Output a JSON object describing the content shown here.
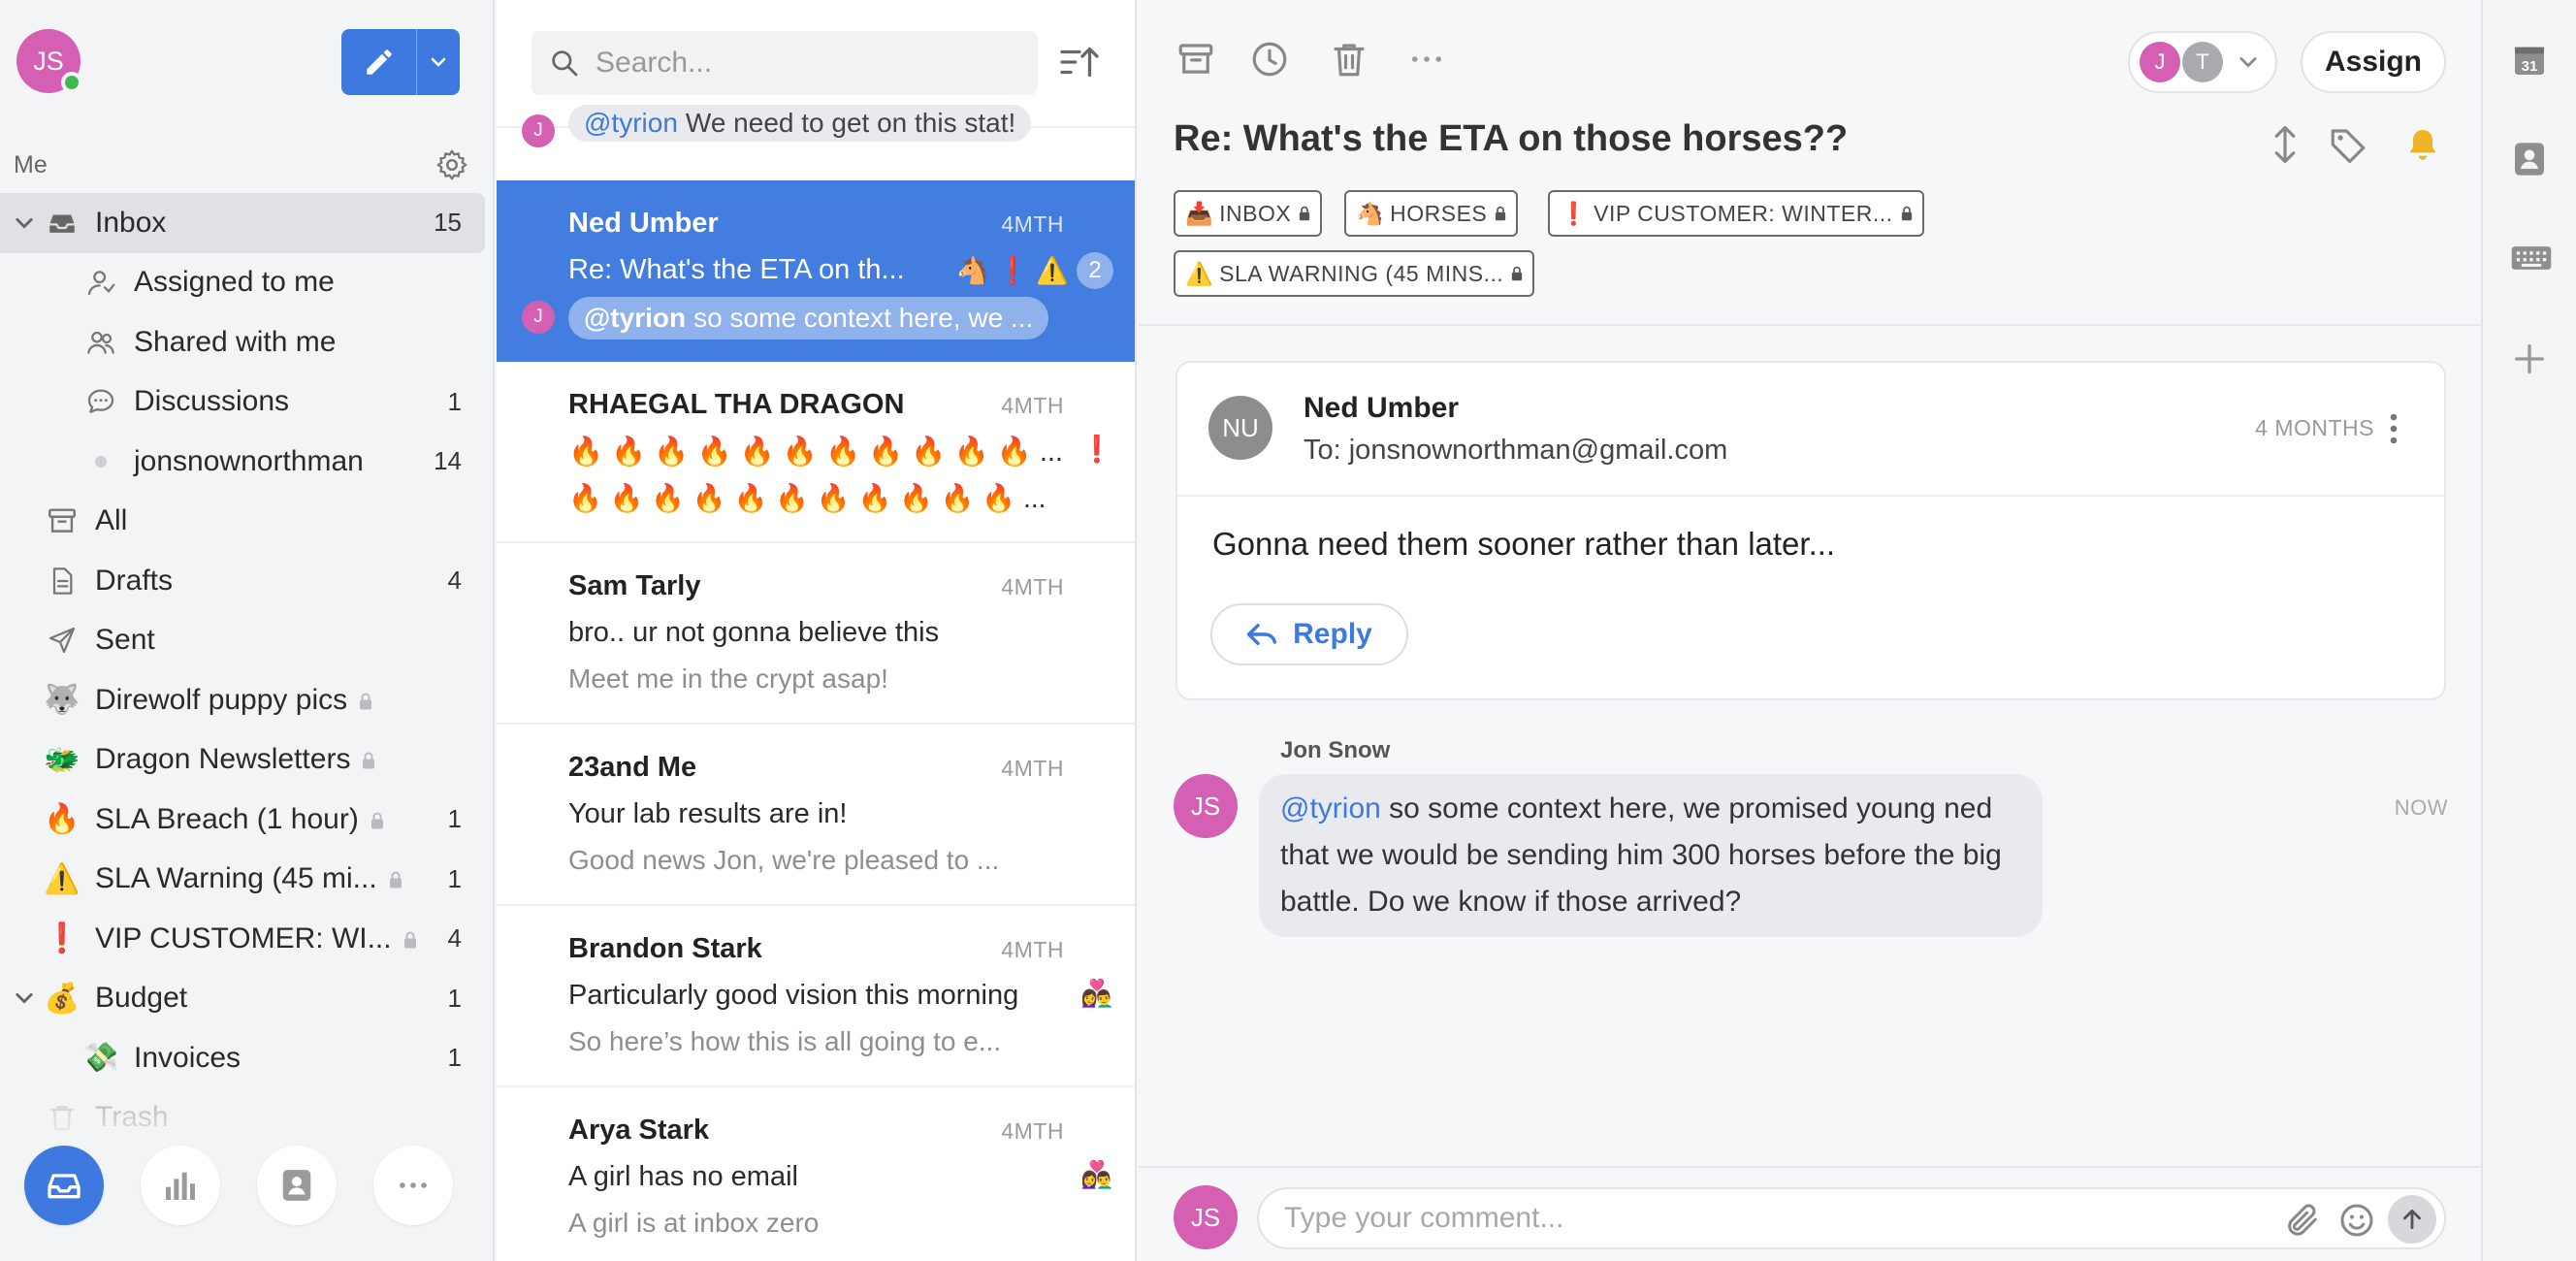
{
  "sidebar": {
    "user_initials": "JS",
    "me_label": "Me",
    "nav": [
      {
        "label": "Inbox",
        "count": "15",
        "icon": "inbox-icon",
        "active": true,
        "chevron": true
      },
      {
        "label": "Assigned to me",
        "count": "",
        "icon": "assigned-icon",
        "sub": true
      },
      {
        "label": "Shared with me",
        "count": "",
        "icon": "shared-icon",
        "sub": true
      },
      {
        "label": "Discussions",
        "count": "1",
        "icon": "discussions-icon",
        "sub": true
      },
      {
        "label": "jonsnownorthman",
        "count": "14",
        "icon": "dot-icon",
        "sub": true
      },
      {
        "label": "All",
        "count": "",
        "icon": "archive-icon"
      },
      {
        "label": "Drafts",
        "count": "4",
        "icon": "drafts-icon"
      },
      {
        "label": "Sent",
        "count": "",
        "icon": "sent-icon"
      },
      {
        "label": "Direwolf puppy pics",
        "count": "",
        "emoji": "🐺",
        "locked": true
      },
      {
        "label": "Dragon Newsletters",
        "count": "",
        "emoji": "🐲",
        "locked": true
      },
      {
        "label": "SLA Breach (1 hour)",
        "count": "1",
        "emoji": "🔥",
        "locked": true
      },
      {
        "label": "SLA Warning (45 mi...",
        "count": "1",
        "emoji": "⚠️",
        "locked": true
      },
      {
        "label": "VIP CUSTOMER: WI...",
        "count": "4",
        "emoji": "❗",
        "locked": true
      },
      {
        "label": "Budget",
        "count": "1",
        "emoji": "💰",
        "chevron": true
      },
      {
        "label": "Invoices",
        "count": "1",
        "emoji": "💸",
        "sub": true
      },
      {
        "label": "Trash",
        "count": "",
        "icon": "trash-icon",
        "faded": true
      }
    ]
  },
  "list": {
    "search_placeholder": "Search...",
    "partial": {
      "avatar": "J",
      "mention": "@tyrion",
      "text": "We need to get on this stat!"
    },
    "messages": [
      {
        "sender": "Ned Umber",
        "time": "4MTH",
        "line1": "Re: What's the ETA on th...",
        "badges": "🐴 ❗ ⚠️",
        "count": "2",
        "comment_avatar": "J",
        "comment_mention": "@tyrion",
        "comment_text": "so some context here, we ...",
        "selected": true
      },
      {
        "sender": "RHAEGAL THA DRAGON",
        "time": "4MTH",
        "line1": "🔥 🔥 🔥 🔥 🔥 🔥 🔥 🔥 🔥 🔥 🔥  ...",
        "line1_badge": "❗",
        "line2": "🔥 🔥 🔥 🔥 🔥 🔥 🔥 🔥 🔥 🔥 🔥  ...",
        "line2_dark": true
      },
      {
        "sender": "Sam Tarly",
        "time": "4MTH",
        "line1": "bro.. ur not gonna believe this",
        "line2": "Meet me in the crypt asap!"
      },
      {
        "sender": "23and Me",
        "time": "4MTH",
        "line1": "Your lab results are in!",
        "line2": "Good news Jon, we're pleased to ..."
      },
      {
        "sender": "Brandon Stark",
        "time": "4MTH",
        "line1": "Particularly good vision this morning",
        "line1_badge": "👩‍❤️‍👨",
        "line2": "So here’s how this is all going to e..."
      },
      {
        "sender": "Arya Stark",
        "time": "4MTH",
        "line1": "A girl has no email",
        "line1_badge": "👩‍❤️‍👨",
        "line2": "A girl is at inbox zero"
      }
    ]
  },
  "conversation": {
    "assignees": [
      "J",
      "T"
    ],
    "assign_label": "Assign",
    "subject": "Re: What's the ETA on those horses??",
    "tags": [
      {
        "emoji": "📥",
        "label": "INBOX"
      },
      {
        "emoji": "🐴",
        "label": "HORSES"
      },
      {
        "emoji": "❗",
        "label": "VIP CUSTOMER: WINTER..."
      },
      {
        "emoji": "⚠️",
        "label": "SLA WARNING (45 MINS..."
      }
    ],
    "email": {
      "initials": "NU",
      "from": "Ned Umber",
      "to": "To: jonsnownorthman@gmail.com",
      "time": "4 MONTHS",
      "body": "Gonna need them sooner rather than later...",
      "reply_label": "Reply"
    },
    "comment": {
      "author": "Jon Snow",
      "initials": "JS",
      "mention": "@tyrion",
      "text": " so some context here, we promised young ned that we would be sending him 300 horses before the big battle. Do we know if those arrived?",
      "time": "NOW"
    },
    "composer": {
      "initials": "JS",
      "placeholder": "Type your comment..."
    }
  },
  "rail": {
    "calendar_day": "31"
  },
  "colors": {
    "accent": "#3d79de",
    "selected_row": "#437ddf",
    "avatar_pink": "#d55fb3",
    "online": "#3fb950"
  }
}
